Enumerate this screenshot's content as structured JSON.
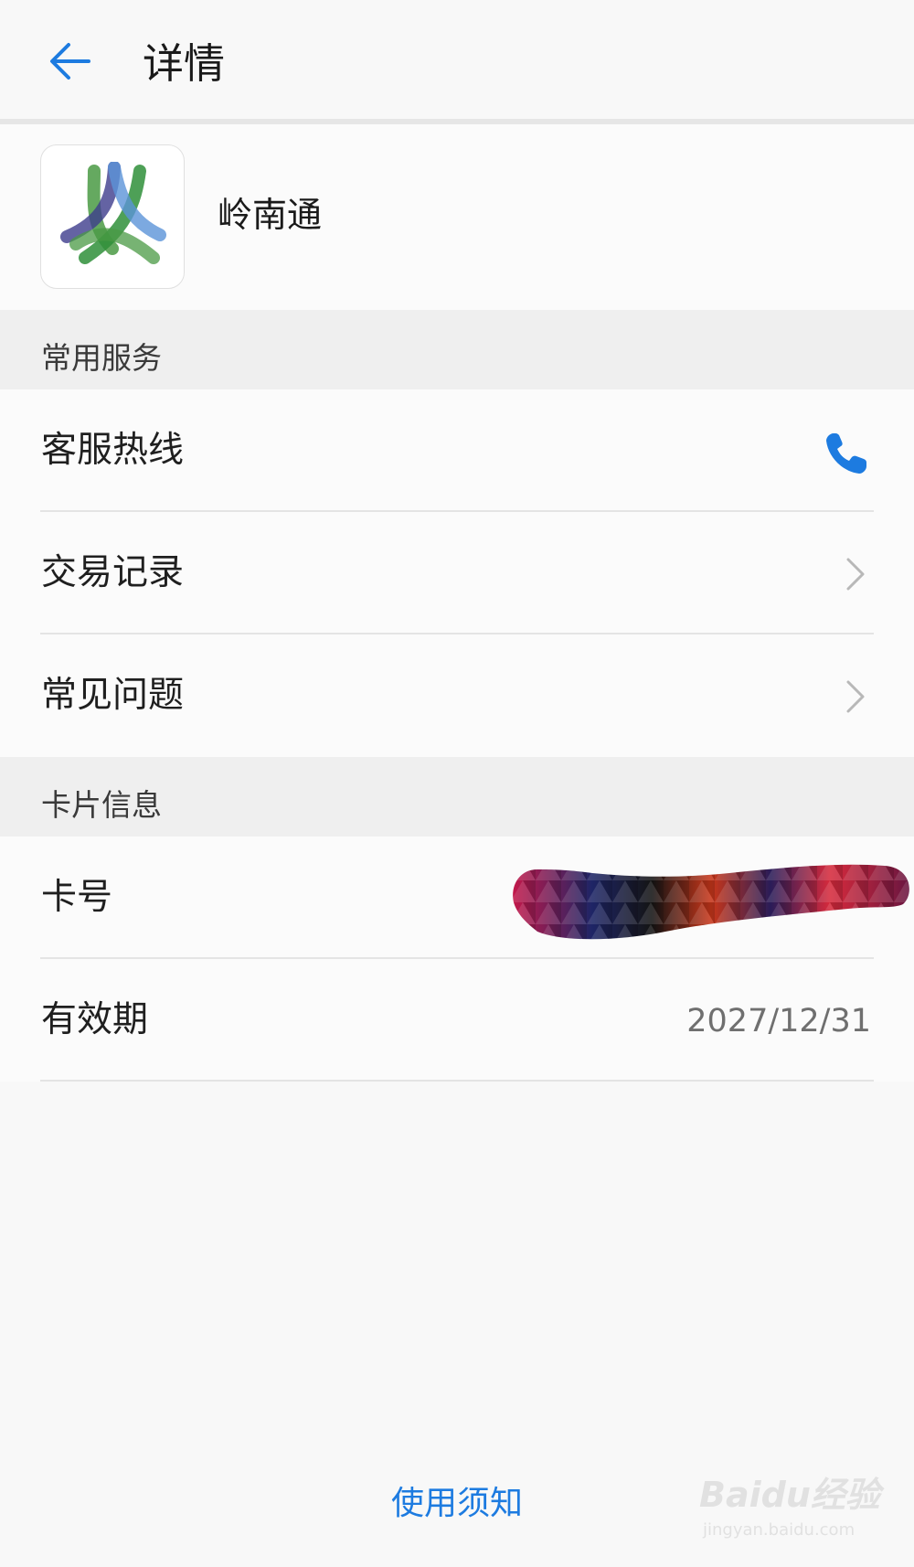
{
  "header": {
    "title": "详情",
    "back_icon": "arrow-left-icon"
  },
  "app": {
    "name": "岭南通",
    "logo_icon": "lingnantong-logo"
  },
  "sections": {
    "services": {
      "title": "常用服务",
      "items": [
        {
          "label": "客服热线",
          "action_icon": "phone-icon"
        },
        {
          "label": "交易记录",
          "action_icon": "chevron-right-icon"
        },
        {
          "label": "常见问题",
          "action_icon": "chevron-right-icon"
        }
      ]
    },
    "card_info": {
      "title": "卡片信息",
      "items": [
        {
          "label": "卡号"
        },
        {
          "label": "有效期",
          "value": "2027/12/31"
        }
      ]
    }
  },
  "footer": {
    "link_label": "使用须知"
  },
  "watermark": {
    "main": "Baidu经验",
    "sub": "jingyan.baidu.com"
  },
  "colors": {
    "accent": "#1d7be0",
    "background": "#f8f8f8",
    "section_bg": "#efefef"
  }
}
